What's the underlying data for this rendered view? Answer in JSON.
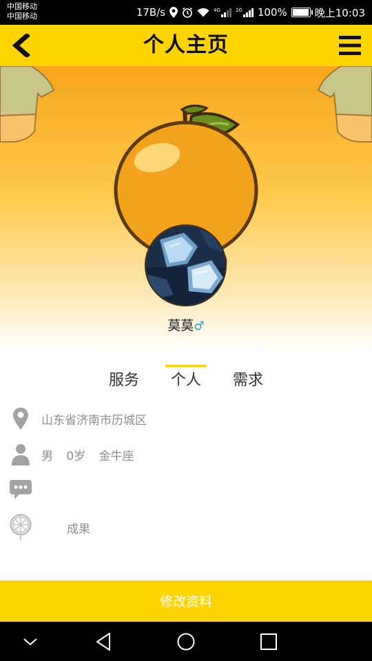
{
  "status_bar": {
    "carrier_1": "中国移动",
    "carrier_2": "中国移动",
    "net_speed": "17B/s",
    "net_type_1": "4G",
    "net_type_2": "2G",
    "battery": "100%",
    "time": "晚上10:03"
  },
  "header": {
    "title": "个人主页",
    "back_icon": "chevron-left-icon",
    "menu_icon": "hamburger-menu-icon"
  },
  "profile": {
    "nickname": "莫莫",
    "gender_symbol": "♂"
  },
  "tabs": [
    {
      "label": "服务",
      "active": false
    },
    {
      "label": "个人",
      "active": true
    },
    {
      "label": "需求",
      "active": false
    }
  ],
  "info": {
    "location": "山东省济南市历城区",
    "gender": "男",
    "age": "0岁",
    "zodiac": "金牛座",
    "signature": "",
    "achievement_label": "成果"
  },
  "edit_button": {
    "label": "修改资料"
  },
  "colors": {
    "brand_yellow": "#ffd400",
    "hero_orange": "#f7a51c",
    "muted_text": "#8d8d8d",
    "icon_gray": "#a3a3a3"
  }
}
